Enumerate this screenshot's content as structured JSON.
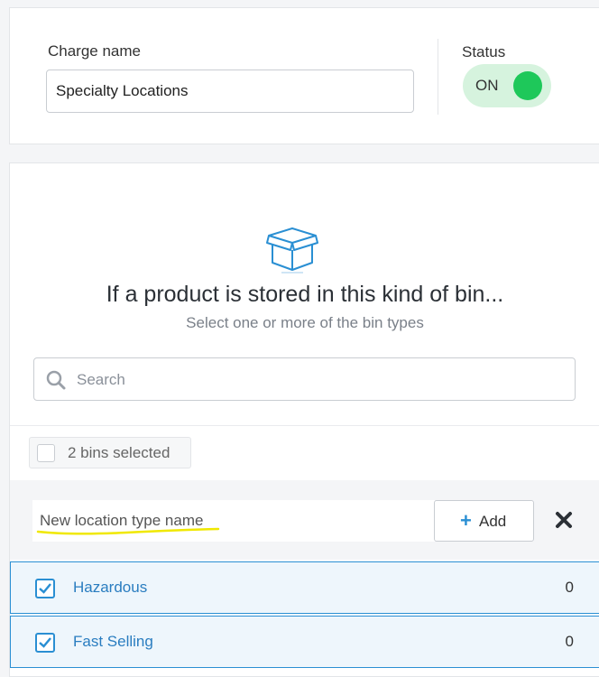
{
  "charge": {
    "label": "Charge name",
    "value": "Specialty Locations"
  },
  "status": {
    "label": "Status",
    "toggle_text": "ON",
    "on": true,
    "color": "#1ec85a"
  },
  "bins": {
    "icon": "open-box-icon",
    "heading": "If a product is stored in this kind of bin...",
    "subheading": "Select one or more of the bin types",
    "search_placeholder": "Search",
    "selected_text": "2 bins selected",
    "new_location_placeholder": "New location type name",
    "add_label": "Add",
    "accent_color": "#2a8fd3",
    "items": [
      {
        "name": "Hazardous",
        "count": "0",
        "checked": true
      },
      {
        "name": "Fast Selling",
        "count": "0",
        "checked": true
      }
    ]
  }
}
